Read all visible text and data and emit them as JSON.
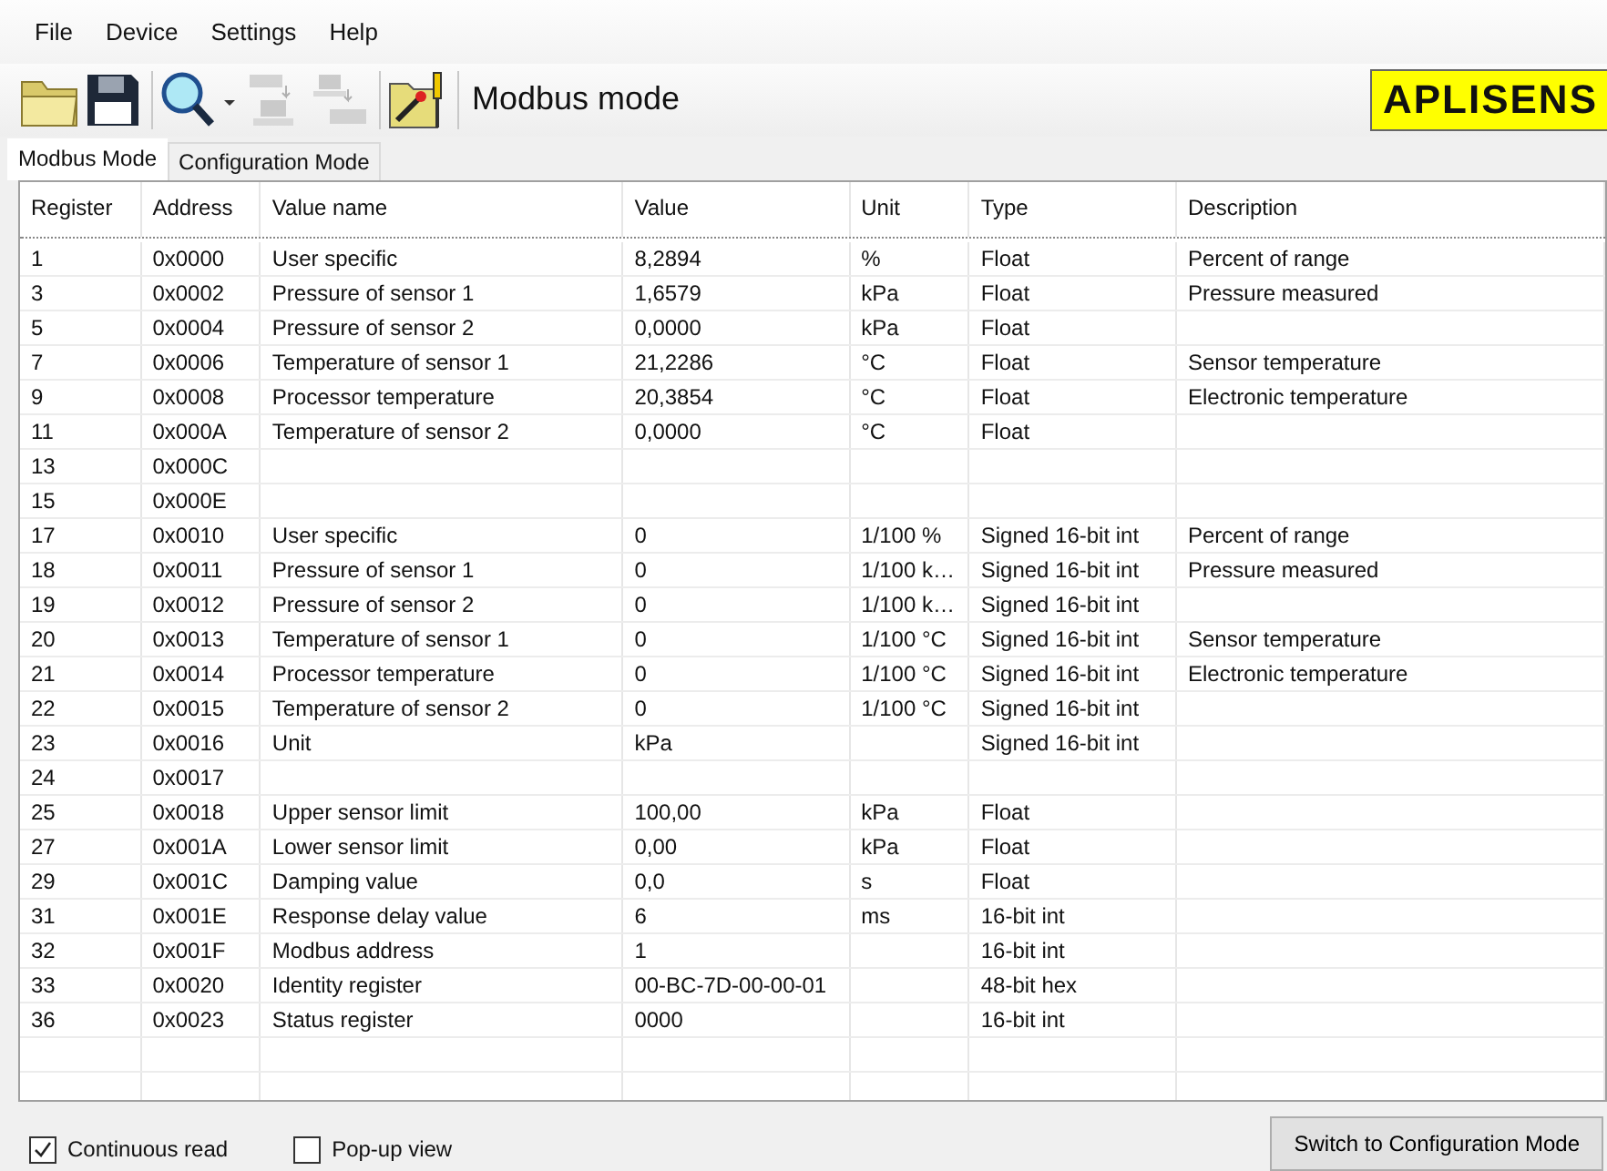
{
  "menu": [
    "File",
    "Device",
    "Settings",
    "Help"
  ],
  "toolbar": {
    "tools": [
      {
        "kind": "open",
        "disabled": false
      },
      {
        "kind": "save",
        "disabled": false
      },
      {
        "kind": "search",
        "disabled": false
      },
      {
        "kind": "read",
        "disabled": true
      },
      {
        "kind": "write",
        "disabled": true
      },
      {
        "kind": "config",
        "disabled": false
      }
    ],
    "mode_label": "Modbus mode",
    "logo": "APLISENS"
  },
  "tabs": [
    {
      "label": "Modbus Mode",
      "selected": true
    },
    {
      "label": "Configuration Mode",
      "selected": false
    }
  ],
  "table": {
    "columns": [
      "Register",
      "Address",
      "Value name",
      "Value",
      "Unit",
      "Type",
      "Description"
    ],
    "rows": [
      {
        "register": "1",
        "address": "0x0000",
        "value_name": "User specific",
        "value": "8,2894",
        "unit": "%",
        "type": "Float",
        "description": "Percent of range"
      },
      {
        "register": "3",
        "address": "0x0002",
        "value_name": "Pressure of sensor 1",
        "value": "1,6579",
        "unit": "kPa",
        "type": "Float",
        "description": "Pressure measured"
      },
      {
        "register": "5",
        "address": "0x0004",
        "value_name": "Pressure of sensor 2",
        "value": "0,0000",
        "unit": "kPa",
        "type": "Float"
      },
      {
        "register": "7",
        "address": "0x0006",
        "value_name": "Temperature of sensor 1",
        "value": "21,2286",
        "unit": "°C",
        "type": "Float",
        "description": "Sensor temperature"
      },
      {
        "register": "9",
        "address": "0x0008",
        "value_name": "Processor temperature",
        "value": "20,3854",
        "unit": "°C",
        "type": "Float",
        "description": "Electronic temperature"
      },
      {
        "register": "11",
        "address": "0x000A",
        "value_name": "Temperature of sensor 2",
        "value": "0,0000",
        "unit": "°C",
        "type": "Float"
      },
      {
        "register": "13",
        "address": "0x000C"
      },
      {
        "register": "15",
        "address": "0x000E"
      },
      {
        "register": "17",
        "address": "0x0010",
        "value_name": "User specific",
        "value": "0",
        "unit": "1/100 %",
        "type": "Signed 16-bit int",
        "description": "Percent of range"
      },
      {
        "register": "18",
        "address": "0x0011",
        "value_name": "Pressure of sensor 1",
        "value": "0",
        "unit": "1/100 k…",
        "type": "Signed 16-bit int",
        "description": "Pressure measured"
      },
      {
        "register": "19",
        "address": "0x0012",
        "value_name": "Pressure of sensor 2",
        "value": "0",
        "unit": "1/100 k…",
        "type": "Signed 16-bit int"
      },
      {
        "register": "20",
        "address": "0x0013",
        "value_name": "Temperature of sensor 1",
        "value": "0",
        "unit": "1/100 °C",
        "type": "Signed 16-bit int",
        "description": "Sensor temperature"
      },
      {
        "register": "21",
        "address": "0x0014",
        "value_name": "Processor temperature",
        "value": "0",
        "unit": "1/100 °C",
        "type": "Signed 16-bit int",
        "description": "Electronic temperature"
      },
      {
        "register": "22",
        "address": "0x0015",
        "value_name": "Temperature of sensor 2",
        "value": "0",
        "unit": "1/100 °C",
        "type": "Signed 16-bit int"
      },
      {
        "register": "23",
        "address": "0x0016",
        "value_name": "Unit",
        "value": "kPa",
        "type": "Signed 16-bit int"
      },
      {
        "register": "24",
        "address": "0x0017"
      },
      {
        "register": "25",
        "address": "0x0018",
        "value_name": "Upper sensor limit",
        "value": "100,00",
        "unit": "kPa",
        "type": "Float"
      },
      {
        "register": "27",
        "address": "0x001A",
        "value_name": "Lower sensor limit",
        "value": "0,00",
        "unit": "kPa",
        "type": "Float"
      },
      {
        "register": "29",
        "address": "0x001C",
        "value_name": "Damping value",
        "value": "0,0",
        "unit": "s",
        "type": "Float"
      },
      {
        "register": "31",
        "address": "0x001E",
        "value_name": "Response delay value",
        "value": "6",
        "unit": "ms",
        "type": "16-bit int"
      },
      {
        "register": "32",
        "address": "0x001F",
        "value_name": "Modbus address",
        "value": "1",
        "type": "16-bit int"
      },
      {
        "register": "33",
        "address": "0x0020",
        "value_name": "Identity register",
        "value": "00-BC-7D-00-00-01",
        "type": "48-bit hex"
      },
      {
        "register": "36",
        "address": "0x0023",
        "value_name": "Status register",
        "value": "0000",
        "type": "16-bit int"
      }
    ]
  },
  "options": [
    {
      "label": "Continuous read",
      "checked": true
    },
    {
      "label": "Pop-up view",
      "checked": false
    }
  ],
  "switch_button": "Switch to Configuration Mode"
}
